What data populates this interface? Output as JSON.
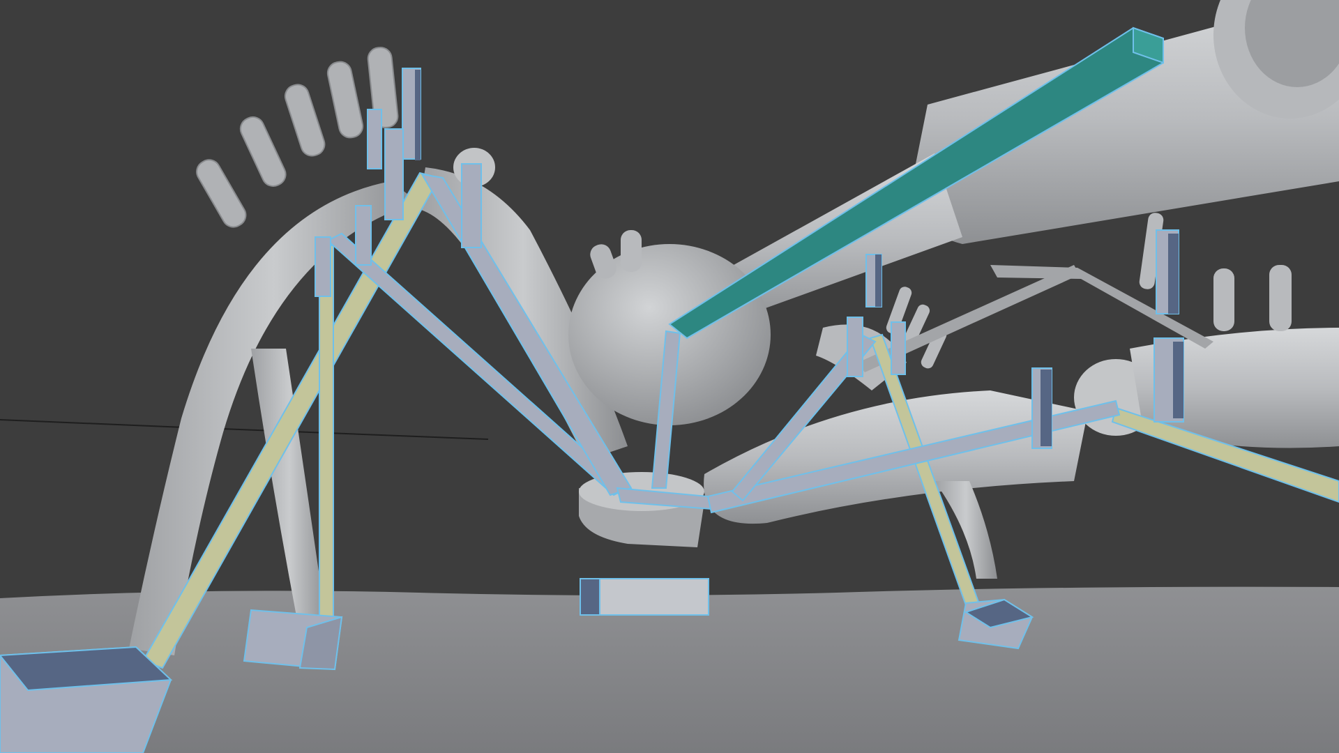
{
  "viewport": {
    "background": "#3d3d3d",
    "colors": {
      "ground": "#8b8b8d",
      "mesh_light": "#c7c9cb",
      "mesh_mid": "#a9abae",
      "mesh_dark": "#7d7f82",
      "bone_default": "#a7adbd",
      "bone_selected_outline": "#6fc0ea",
      "bone_active": "#2d8781",
      "bone_ik": "#c3c59a",
      "bone_dark_face": "#566684"
    },
    "objects": [
      "character-body-mesh",
      "armature-bones",
      "ground-plane"
    ]
  }
}
